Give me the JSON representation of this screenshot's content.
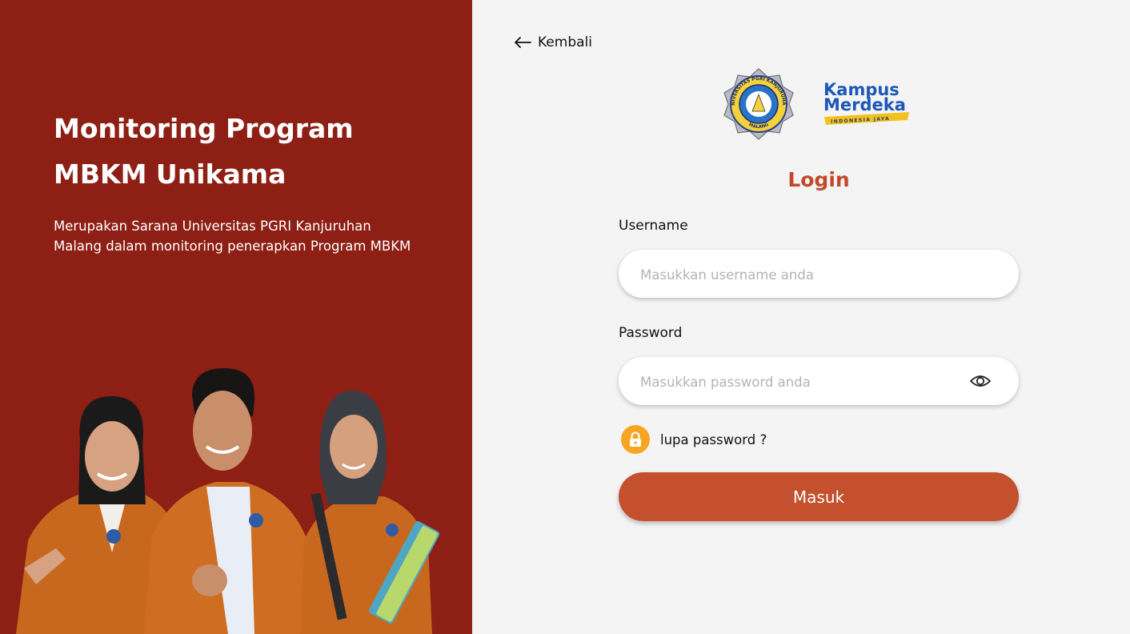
{
  "hero": {
    "title_line1": "Monitoring Program",
    "title_line2": "MBKM Unikama",
    "subtitle_line1": "Merupakan  Sarana Universitas PGRI Kanjuruhan",
    "subtitle_line2": "Malang dalam monitoring penerapkan Program MBKM"
  },
  "nav": {
    "back_label": "Kembali",
    "back_icon": "arrow-left-icon"
  },
  "logos": {
    "unikama_ring_text": "UNIVERSITAS PGRI KANJURUHAN",
    "unikama_bottom_text": "MALANG",
    "kampus_line1": "Kampus",
    "kampus_line2": "Merdeka",
    "kampus_tagline": "INDONESIA JAYA"
  },
  "form": {
    "title": "Login",
    "username_label": "Username",
    "username_placeholder": "Masukkan username anda",
    "password_label": "Password",
    "password_placeholder": "Masukkan password anda",
    "forgot_label": "lupa password ?",
    "submit_label": "Masuk"
  },
  "colors": {
    "left_panel": "#8d1f15",
    "accent": "#c4502e",
    "title": "#c24a2c",
    "lock_badge": "#f6a623",
    "jacket": "#c8681f"
  }
}
